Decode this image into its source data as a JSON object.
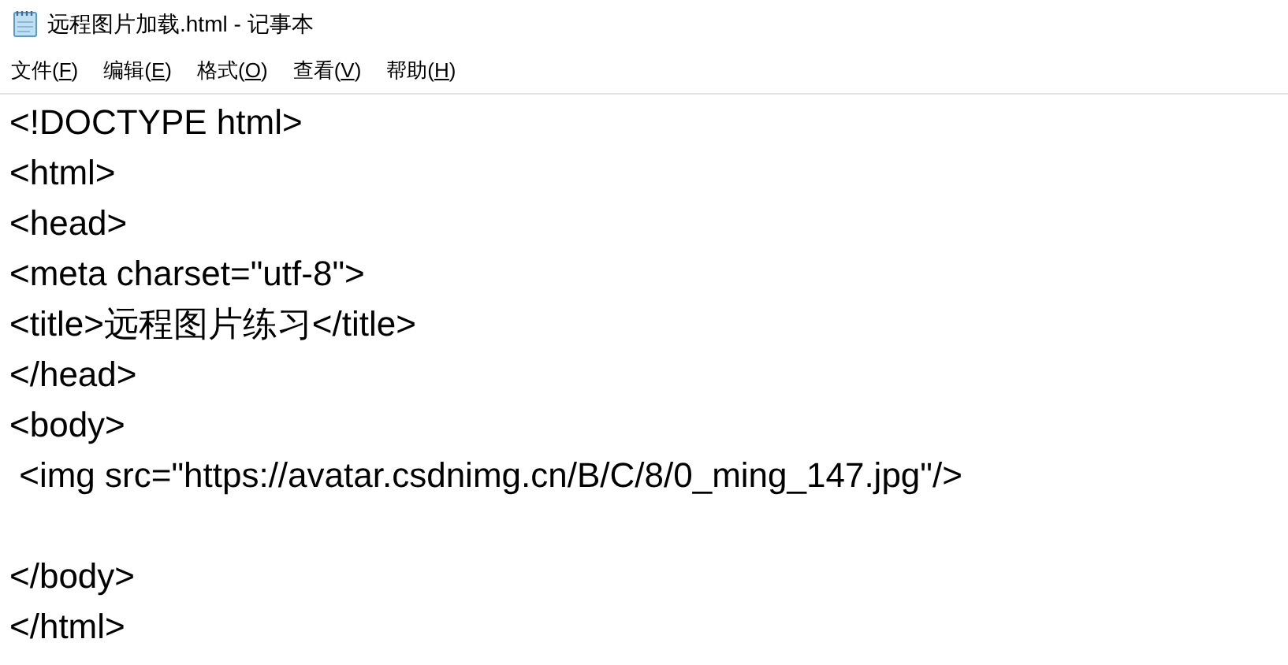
{
  "window": {
    "title": "远程图片加载.html - 记事本"
  },
  "menu": [
    {
      "parts": [
        "文件(",
        "F",
        ")"
      ]
    },
    {
      "parts": [
        "编辑(",
        "E",
        ")"
      ]
    },
    {
      "parts": [
        "格式(",
        "O",
        ")"
      ]
    },
    {
      "parts": [
        "查看(",
        "V",
        ")"
      ]
    },
    {
      "parts": [
        "帮助(",
        "H",
        ")"
      ]
    }
  ],
  "editor": {
    "text": "<!DOCTYPE html>\n<html>\n<head>\n<meta charset=\"utf-8\">\n<title>远程图片练习</title>\n</head>\n<body>\n <img src=\"https://avatar.csdnimg.cn/B/C/8/0_ming_147.jpg\"/>\n\n</body>\n</html>"
  }
}
